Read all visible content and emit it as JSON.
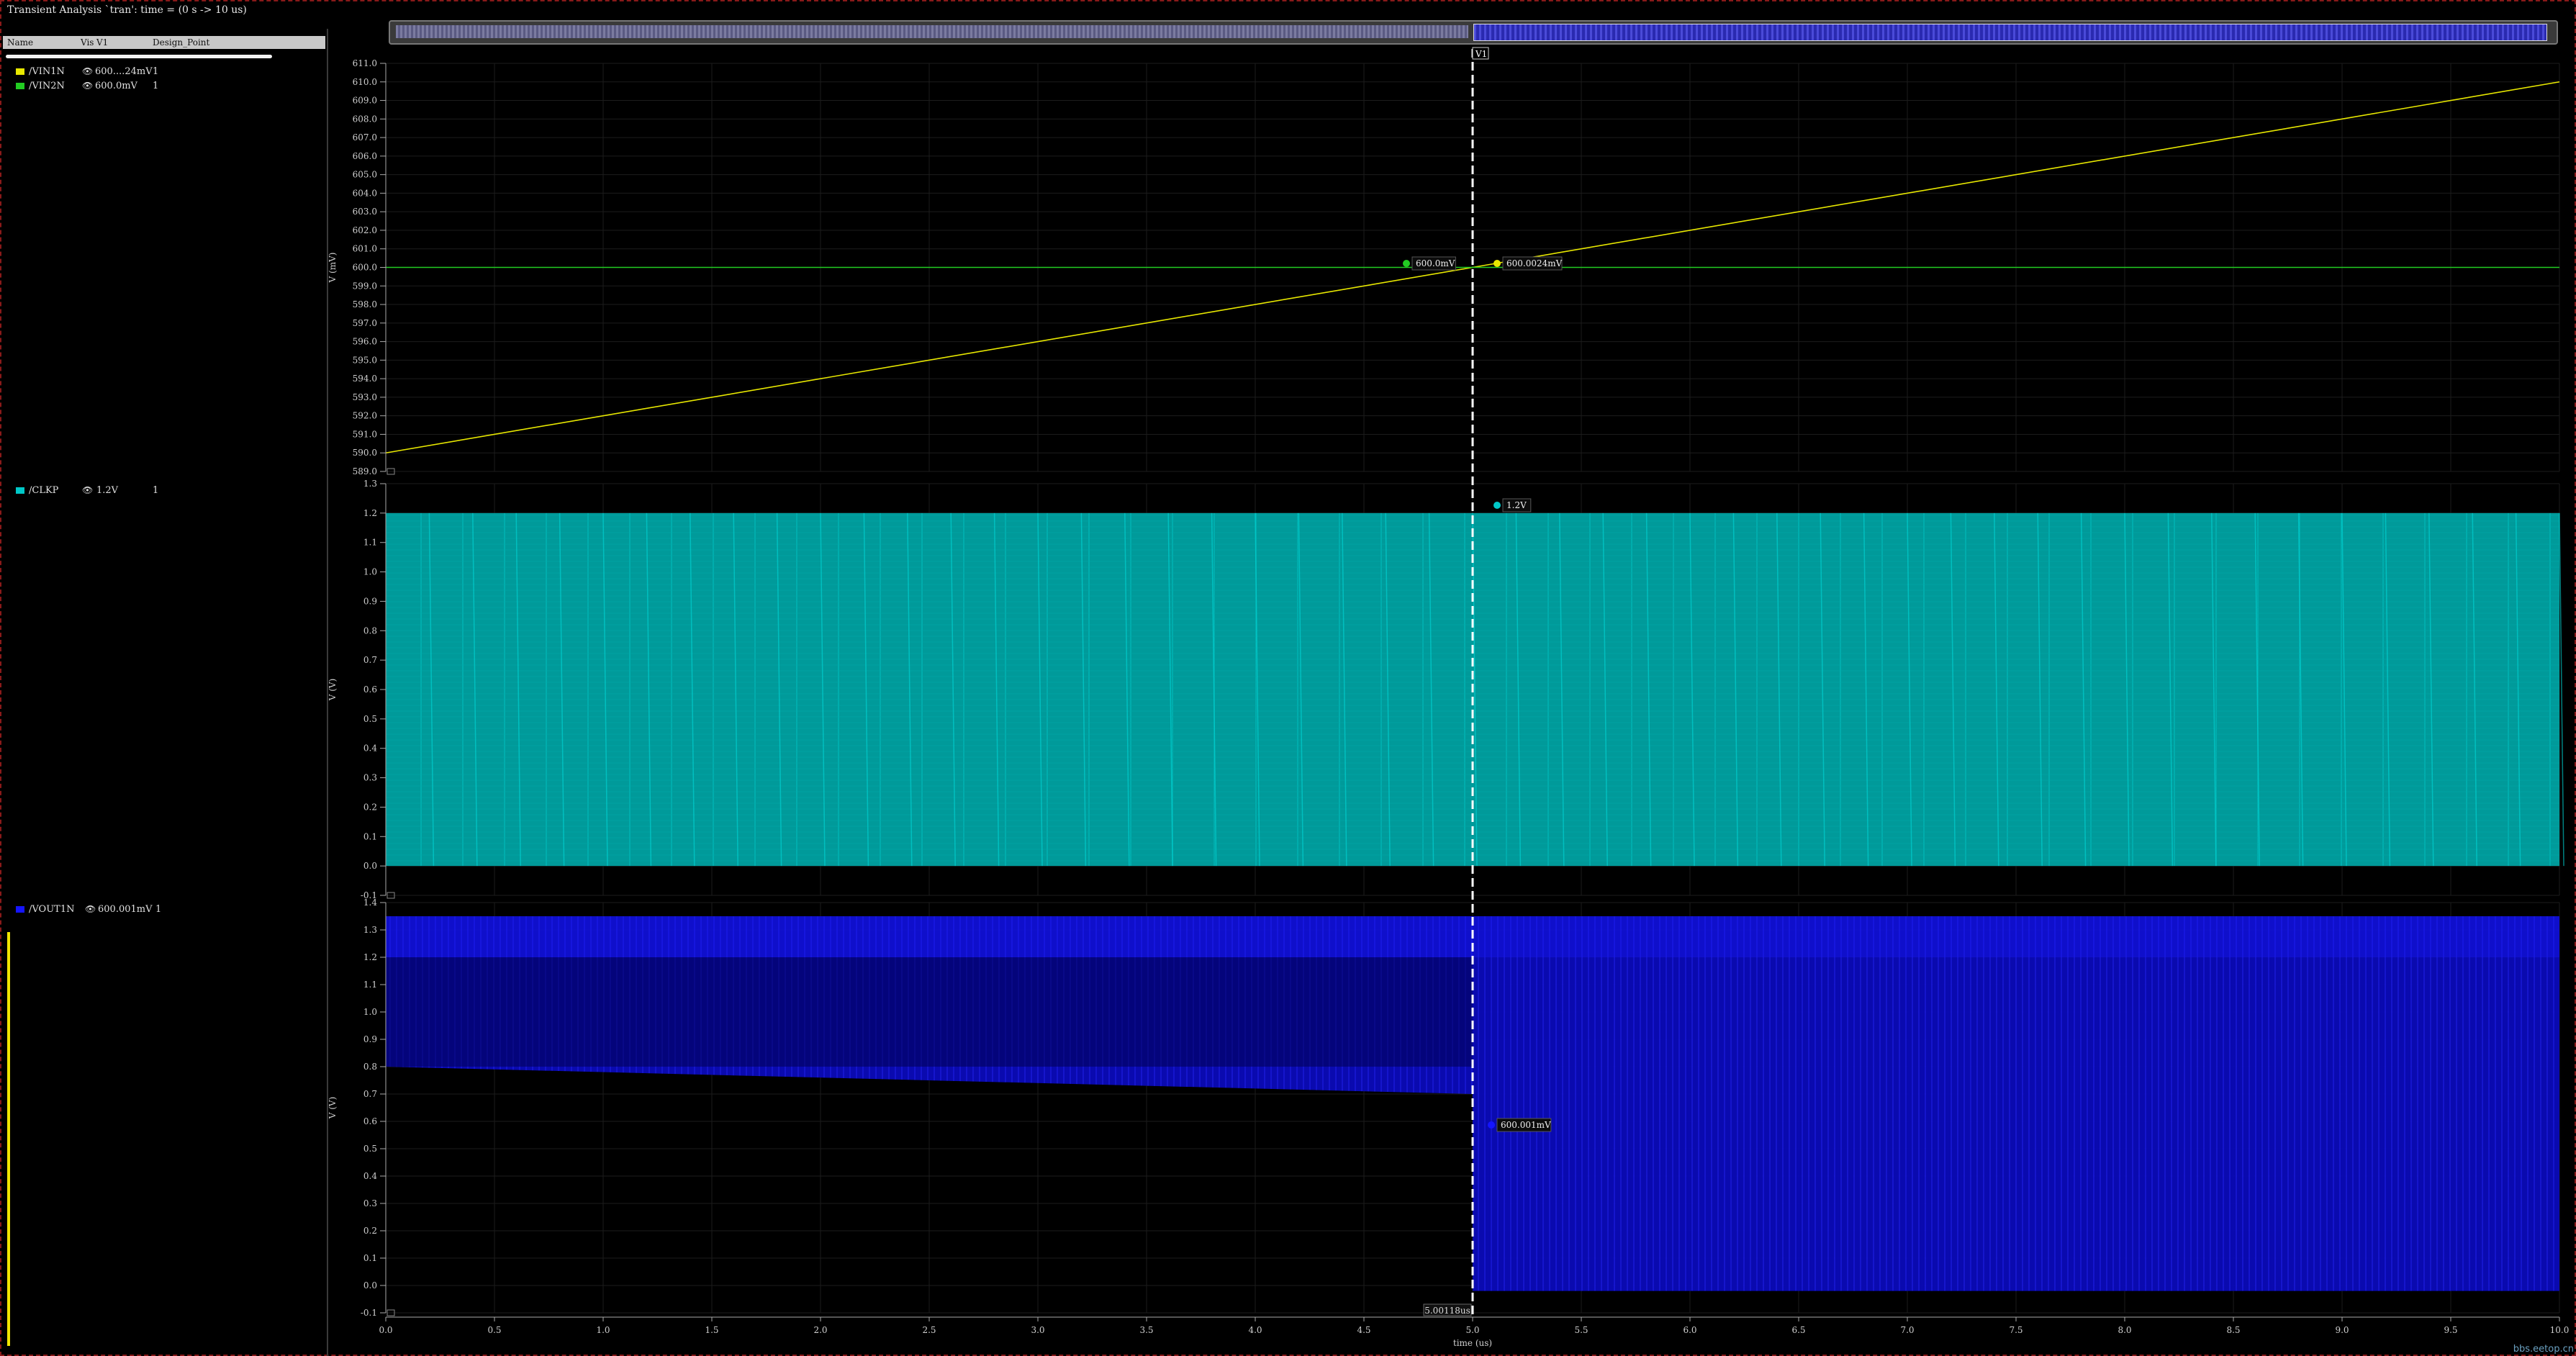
{
  "window": {
    "title": "Transient Analysis `tran': time = (0 s -> 10 us)"
  },
  "table": {
    "col_name": "Name",
    "col_vis": "Vis",
    "col_v1": "V1",
    "col_dp": "Design_Point"
  },
  "signals": {
    "vin1n": {
      "name": "/VIN1N",
      "value": "600....24mV",
      "dp": "1",
      "color": "#e8e800"
    },
    "vin2n": {
      "name": "/VIN2N",
      "value": "600.0mV",
      "dp": "1",
      "color": "#22cc22"
    },
    "clkp": {
      "name": "/CLKP",
      "value": "1.2V",
      "dp": "1",
      "color": "#00c8c8"
    },
    "vout1n": {
      "name": "/VOUT1N",
      "value": "600.001mV",
      "dp": "1",
      "color": "#1515ff"
    }
  },
  "cursor": {
    "label": "V1",
    "time_readout": "5.00118us"
  },
  "markers": {
    "vin2n": "600.0mV",
    "vin1n": "600.0024mV",
    "clkp": "1.2V",
    "vout1n": "600.001mV"
  },
  "axes": {
    "strip1": {
      "ylabel": "V (mV)",
      "ticks": [
        "611.0",
        "610.0",
        "609.0",
        "608.0",
        "607.0",
        "606.0",
        "605.0",
        "604.0",
        "603.0",
        "602.0",
        "601.0",
        "600.0",
        "599.0",
        "598.0",
        "597.0",
        "596.0",
        "595.0",
        "594.0",
        "593.0",
        "592.0",
        "591.0",
        "590.0",
        "589.0"
      ]
    },
    "strip2": {
      "ylabel": "V (V)",
      "ticks": [
        "1.3",
        "1.2",
        "1.1",
        "1.0",
        "0.9",
        "0.8",
        "0.7",
        "0.6",
        "0.5",
        "0.4",
        "0.3",
        "0.2",
        "0.1",
        "0.0",
        "-0.1"
      ]
    },
    "strip3": {
      "ylabel": "V (V)",
      "ticks": [
        "1.4",
        "1.3",
        "1.2",
        "1.1",
        "1.0",
        "0.9",
        "0.8",
        "0.7",
        "0.6",
        "0.5",
        "0.4",
        "0.3",
        "0.2",
        "0.1",
        "0.0",
        "-0.1"
      ]
    },
    "x": {
      "xlabel": "time (us)",
      "ticks": [
        "0.0",
        "0.5",
        "1.0",
        "1.5",
        "2.0",
        "2.5",
        "3.0",
        "3.5",
        "4.0",
        "4.5",
        "5.0",
        "5.5",
        "6.0",
        "6.5",
        "7.0",
        "7.5",
        "8.0",
        "8.5",
        "9.0",
        "9.5",
        "10.0"
      ]
    }
  },
  "chart_data": [
    {
      "type": "line",
      "title": "",
      "xlabel": "time (us)",
      "ylabel": "V (mV)",
      "xlim": [
        0,
        10
      ],
      "ylim": [
        589,
        611
      ],
      "series": [
        {
          "name": "/VIN1N",
          "color": "#e8e800",
          "x": [
            0,
            5,
            10
          ],
          "y": [
            590.0,
            600.0,
            610.0
          ]
        },
        {
          "name": "/VIN2N",
          "color": "#22cc22",
          "x": [
            0,
            10
          ],
          "y": [
            600.0,
            600.0
          ]
        }
      ]
    },
    {
      "type": "line",
      "title": "",
      "xlabel": "time (us)",
      "ylabel": "V (V)",
      "xlim": [
        0,
        10
      ],
      "ylim": [
        -0.1,
        1.3
      ],
      "series": [
        {
          "name": "/CLKP",
          "color": "#00c8c8",
          "low": 0.0,
          "high": 1.2
        }
      ]
    },
    {
      "type": "line",
      "title": "",
      "xlabel": "time (us)",
      "ylabel": "V (V)",
      "xlim": [
        0,
        10
      ],
      "ylim": [
        -0.1,
        1.4
      ],
      "series": [
        {
          "name": "/VOUT1N",
          "color": "#1515ff",
          "x": [
            0,
            5,
            5,
            10
          ],
          "upper": [
            1.35,
            1.35,
            1.35,
            1.35
          ],
          "lower": [
            0.8,
            0.7,
            -0.02,
            -0.02
          ]
        }
      ]
    }
  ],
  "footer": {
    "watermark": "bbs.eetop.cn"
  }
}
